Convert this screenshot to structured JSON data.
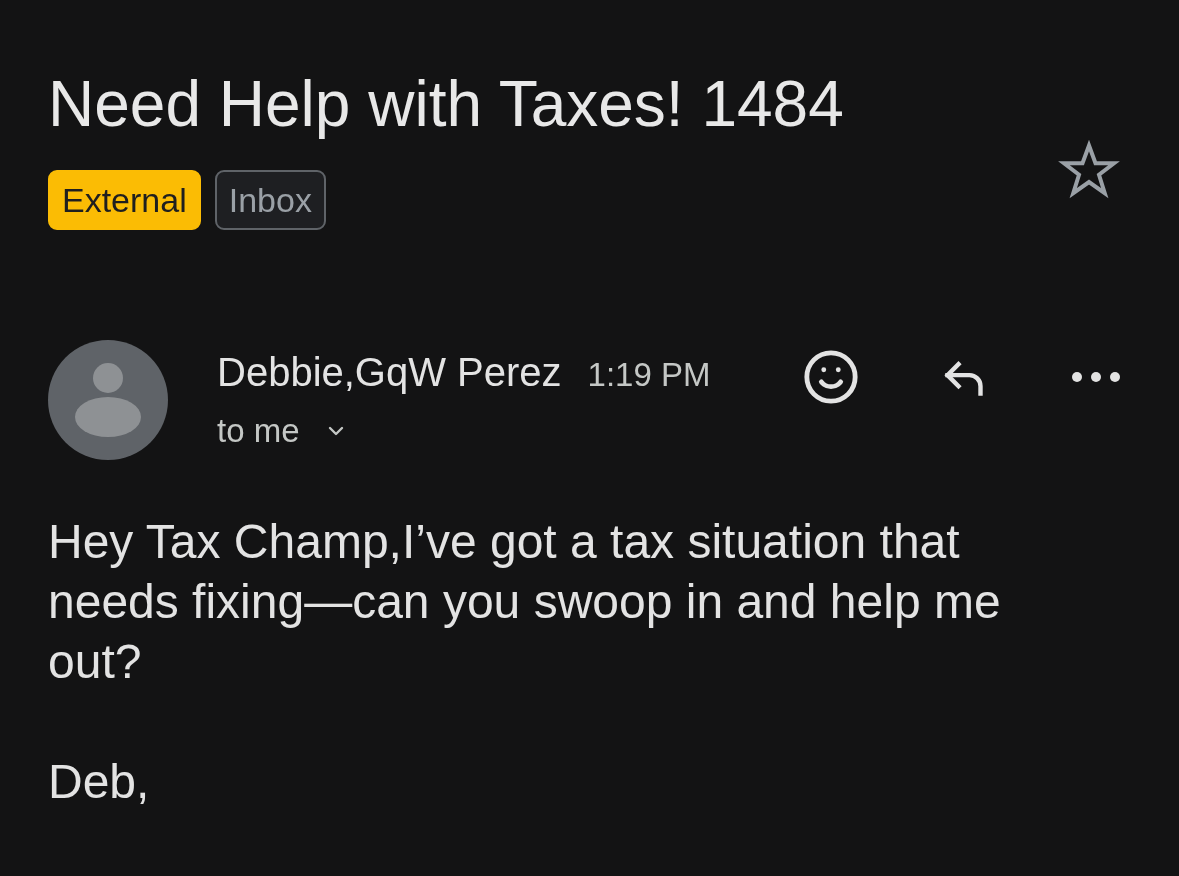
{
  "subject": "Need Help with Taxes! 1484",
  "labels": [
    {
      "text": "External",
      "kind": "external"
    },
    {
      "text": "Inbox",
      "kind": "folder"
    }
  ],
  "starred": false,
  "message": {
    "sender": "Debbie,GqW Perez",
    "time": "1:19 PM",
    "recipients": "to me",
    "body": [
      "Hey Tax Champ,I’ve got a tax situation that needs fixing—can you swoop in and help me out?",
      "Deb,"
    ]
  }
}
